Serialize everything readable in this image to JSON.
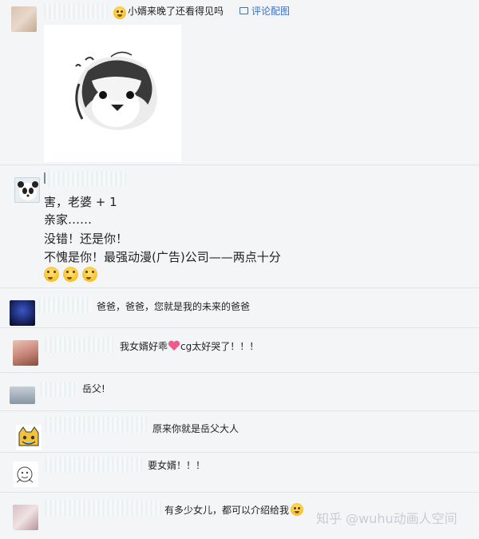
{
  "post": {
    "text": "小婿来晚了还看得见吗",
    "link": "评论配图"
  },
  "reply1": {
    "lines": [
      "害，老婆 + 1",
      "亲家……",
      "没错！还是你！",
      "不愧是你！最强动漫(广告)公司——两点十分"
    ]
  },
  "comments": [
    {
      "text": "爸爸，爸爸，您就是我的未来的爸爸"
    },
    {
      "text_a": "我女婿好乖",
      "text_b": "cg太好哭了！！！"
    },
    {
      "text": "岳父!"
    },
    {
      "text": "原来你就是岳父大人"
    },
    {
      "text": "要女婿！！！"
    },
    {
      "text": "有多少女儿，都可以介绍给我"
    }
  ],
  "watermark": "知乎 @wuhu动画人空间",
  "colors": {
    "link": "#3b6fc2",
    "bg": "#f4f5f7",
    "divider": "#dfe3e8"
  }
}
